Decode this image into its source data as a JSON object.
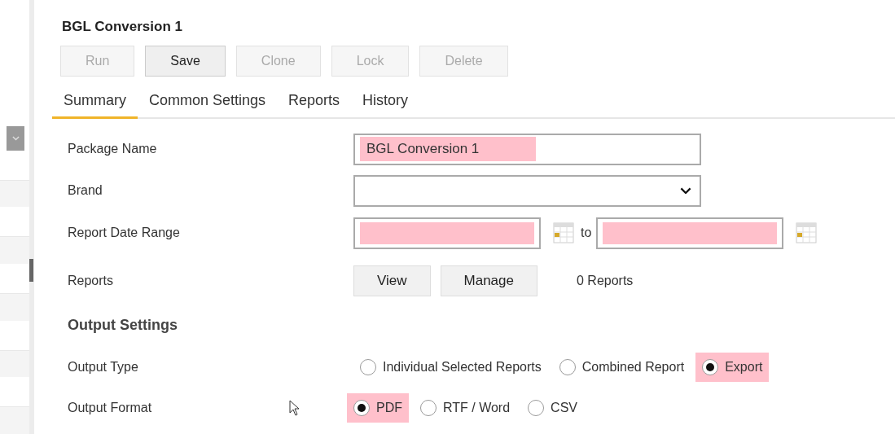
{
  "title": "BGL Conversion 1",
  "toolbar": [
    {
      "label": "Run",
      "disabled": true
    },
    {
      "label": "Save",
      "disabled": false
    },
    {
      "label": "Clone",
      "disabled": true
    },
    {
      "label": "Lock",
      "disabled": true
    },
    {
      "label": "Delete",
      "disabled": true
    }
  ],
  "tabs": [
    {
      "label": "Summary",
      "selected": true
    },
    {
      "label": "Common Settings",
      "selected": false
    },
    {
      "label": "Reports",
      "selected": false
    },
    {
      "label": "History",
      "selected": false
    }
  ],
  "fields": [
    {
      "kind": "text",
      "label": "Package Name",
      "value": "BGL Conversion 1",
      "highlighted": true
    },
    {
      "kind": "select",
      "label": "Brand",
      "highlighted": false
    },
    {
      "kind": "daterange",
      "label": "Report Date Range",
      "separator": "to",
      "highlighted": true
    },
    {
      "kind": "buttons",
      "label": "Reports",
      "buttons": [
        "View",
        "Manage"
      ],
      "note": "0 Reports"
    }
  ],
  "output_settings": {
    "heading": "Output Settings",
    "groups": [
      {
        "label": "Output Type",
        "options": [
          {
            "label": "Individual Selected Reports",
            "selected": false
          },
          {
            "label": "Combined Report",
            "selected": false
          },
          {
            "label": "Export",
            "selected": true
          }
        ]
      },
      {
        "label": "Output Format",
        "options": [
          {
            "label": "PDF",
            "selected": true
          },
          {
            "label": "RTF / Word",
            "selected": false
          },
          {
            "label": "CSV",
            "selected": false
          }
        ]
      }
    ]
  }
}
